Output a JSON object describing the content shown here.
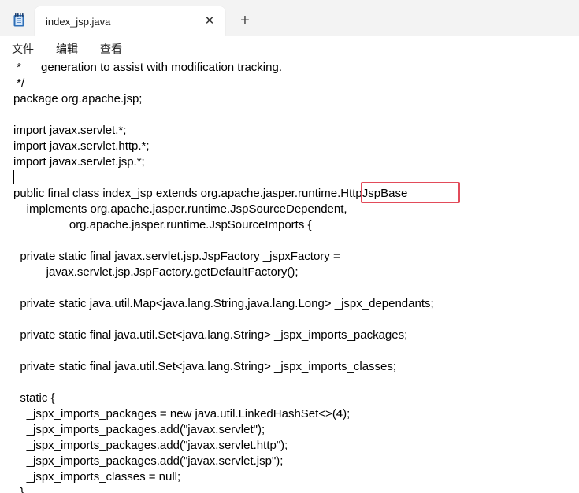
{
  "tab": {
    "title": "index_jsp.java",
    "close_glyph": "✕",
    "new_tab_glyph": "+"
  },
  "menu": {
    "file": "文件",
    "edit": "编辑",
    "view": "查看"
  },
  "code": {
    "lines": [
      " *      generation to assist with modification tracking.",
      " */",
      "package org.apache.jsp;",
      "",
      "import javax.servlet.*;",
      "import javax.servlet.http.*;",
      "import javax.servlet.jsp.*;",
      "",
      "public final class index_jsp extends org.apache.jasper.runtime.HttpJspBase",
      "    implements org.apache.jasper.runtime.JspSourceDependent,",
      "                 org.apache.jasper.runtime.JspSourceImports {",
      "",
      "  private static final javax.servlet.jsp.JspFactory _jspxFactory =",
      "          javax.servlet.jsp.JspFactory.getDefaultFactory();",
      "",
      "  private static java.util.Map<java.lang.String,java.lang.Long> _jspx_dependants;",
      "",
      "  private static final java.util.Set<java.lang.String> _jspx_imports_packages;",
      "",
      "  private static final java.util.Set<java.lang.String> _jspx_imports_classes;",
      "",
      "  static {",
      "    _jspx_imports_packages = new java.util.LinkedHashSet<>(4);",
      "    _jspx_imports_packages.add(\"javax.servlet\");",
      "    _jspx_imports_packages.add(\"javax.servlet.http\");",
      "    _jspx_imports_packages.add(\"javax.servlet.jsp\");",
      "    _jspx_imports_classes = null;",
      "  }"
    ]
  },
  "colors": {
    "highlight_border": "#e24b5a",
    "tabstrip_bg": "#f3f3f3",
    "app_icon": "#2f6fb7"
  },
  "icons": {
    "app": "notepad-icon",
    "close": "close-icon",
    "new_tab": "plus-icon",
    "minimize": "minimize-icon"
  }
}
